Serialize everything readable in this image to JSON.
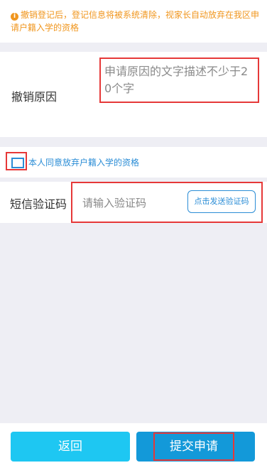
{
  "notice": {
    "icon": "info-icon",
    "text": "撤销登记后，登记信息将被系统清除，视家长自动放弃在我区申请户籍入学的资格"
  },
  "reason": {
    "label": "撤销原因",
    "placeholder": "申请原因的文字描述不少于20个字"
  },
  "agree": {
    "checked": false,
    "text": "本人同意放弃户籍入学的资格"
  },
  "sms": {
    "label": "短信验证码",
    "placeholder": "请输入验证码",
    "send_button": "点击发送验证码"
  },
  "footer": {
    "back_label": "返回",
    "submit_label": "提交申请"
  },
  "colors": {
    "notice": "#f0961e",
    "link_blue": "#2b8dd6",
    "back_button": "#1ec7f2",
    "submit_button": "#1399d9",
    "highlight_red": "#e63838",
    "background": "#eeeef4"
  }
}
